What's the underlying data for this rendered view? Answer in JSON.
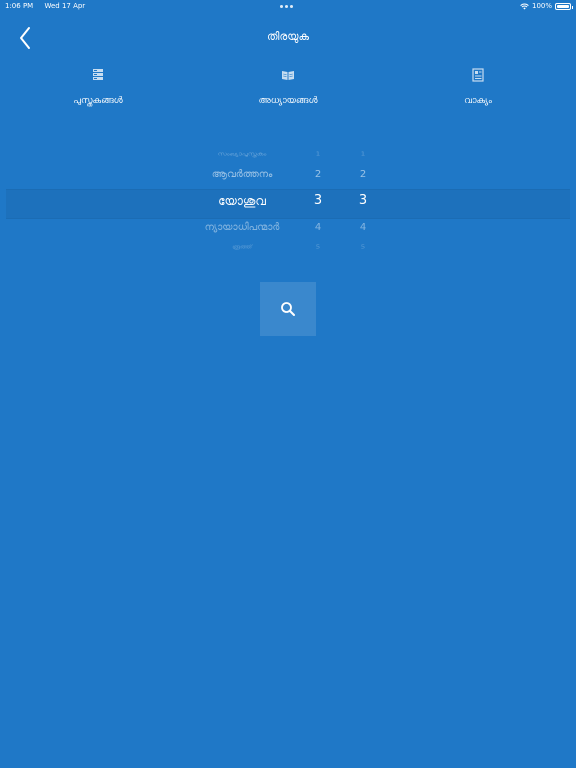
{
  "status_bar": {
    "time": "1:06 PM",
    "date": "Wed 17 Apr",
    "battery": "100%"
  },
  "nav": {
    "title": "തിരയുക",
    "back_icon": "chevron-left-icon"
  },
  "tabs": [
    {
      "label": "പുസ്തകങ്ങൾ",
      "icon": "books-icon"
    },
    {
      "label": "അധ്യായങ്ങൾ",
      "icon": "open-book-icon"
    },
    {
      "label": "വാക്യം",
      "icon": "verse-icon"
    }
  ],
  "picker": {
    "books": [
      "സംഖ്യാപുസ്തകം",
      "ആവർത്തനം",
      "യോശുവ",
      "ന്യായാധിപന്മാർ",
      "രൂത്ത്"
    ],
    "chapters": [
      "1",
      "2",
      "3",
      "4",
      "5"
    ],
    "verses": [
      "1",
      "2",
      "3",
      "4",
      "5"
    ],
    "selected_index": 2
  },
  "search_button": {
    "icon": "search-icon"
  }
}
